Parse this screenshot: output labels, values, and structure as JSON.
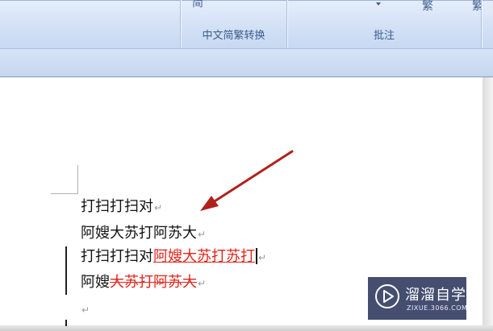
{
  "ribbon": {
    "group_chinese_conversion_label": "中文简繁转换",
    "group_comments_label": "批注",
    "cut_text_left": "简",
    "cut_text_right_1": "繁",
    "cut_text_right_2": "繁"
  },
  "document": {
    "line1": "打扫打扫对",
    "line2": "阿嫂大苏打阿苏大",
    "line3_plain": "打扫打扫对",
    "line3_inserted": "阿嫂大苏打苏打",
    "line4_plain": "阿嫂",
    "line4_deleted": "大苏打阿苏大",
    "paragraph_mark": "↵"
  },
  "watermark": {
    "title": "溜溜自学",
    "subtitle": "ZIXUE.3066.COM"
  },
  "colors": {
    "revision_red": "#e2231a",
    "arrow_red": "#b3201b",
    "ribbon_blue": "#d3e1f6"
  }
}
